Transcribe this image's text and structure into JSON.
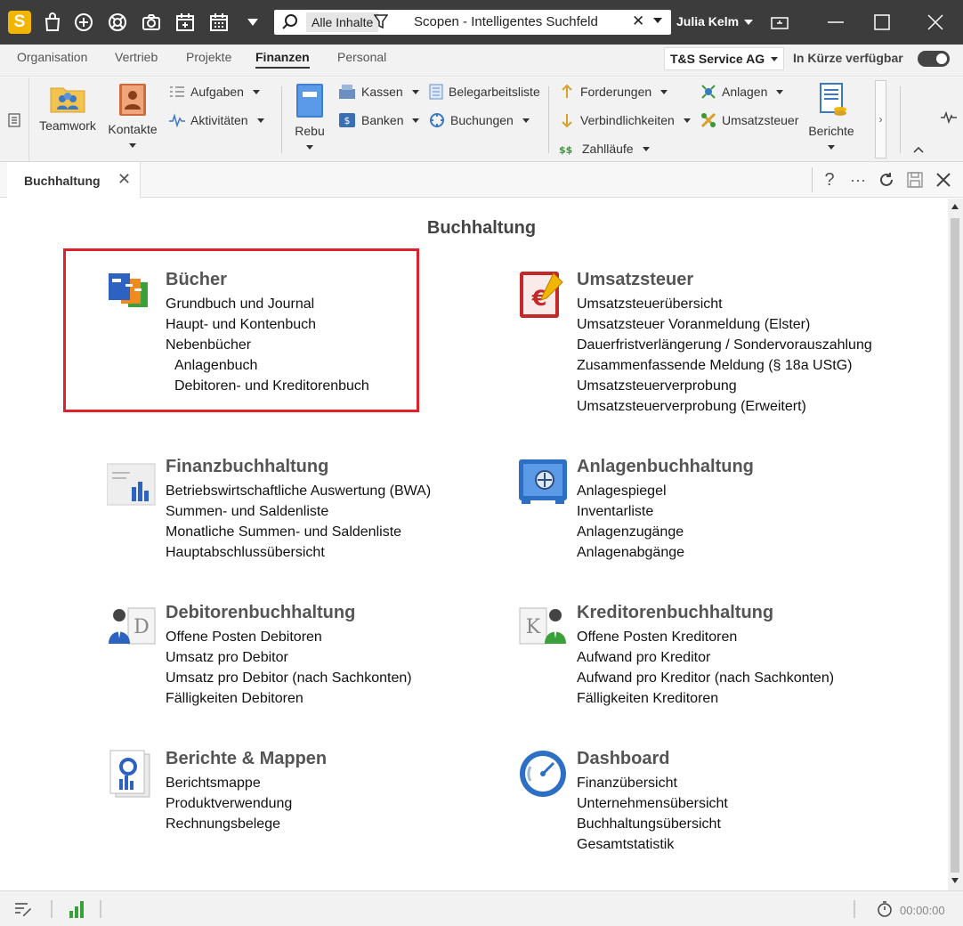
{
  "titlebar": {
    "search_scope": "Alle Inhalte",
    "search_text": "Scopen - Intelligentes Suchfeld",
    "user": "Julia Kelm",
    "app_logo_letter": "S",
    "toolbar_icons": [
      "bag-icon",
      "plus-circle-icon",
      "lifebuoy-icon",
      "camera-icon",
      "calendar-add-icon",
      "calendar-icon",
      "dropdown-triangle-icon"
    ]
  },
  "menu": {
    "tabs": [
      "Organisation",
      "Vertrieb",
      "Projekte",
      "Finanzen",
      "Personal"
    ],
    "active_tab": "Finanzen",
    "company": "T&S Service AG",
    "coming_soon_label": "In Kürze verfügbar"
  },
  "ribbon": {
    "teamwork": "Teamwork",
    "kontakte": "Kontakte",
    "aufgaben": "Aufgaben",
    "aktivitaeten": "Aktivitäten",
    "rebu": "Rebu",
    "kassen": "Kassen",
    "banken": "Banken",
    "belegarbeitsliste": "Belegarbeitsliste",
    "buchungen": "Buchungen",
    "forderungen": "Forderungen",
    "verbindlichkeiten": "Verbindlichkeiten",
    "zahllaeufe": "Zahlläufe",
    "anlagen": "Anlagen",
    "umsatzsteuer": "Umsatzsteuer",
    "berichte": "Berichte"
  },
  "doc_tab": {
    "label": "Buchhaltung"
  },
  "page": {
    "title": "Buchhaltung",
    "sections": {
      "buecher": {
        "title": "Bücher",
        "items": [
          "Grundbuch und Journal",
          "Haupt- und Kontenbuch",
          "Nebenbücher",
          "Anlagenbuch",
          "Debitoren- und Kreditorenbuch"
        ]
      },
      "umsatzsteuer": {
        "title": "Umsatzsteuer",
        "items": [
          "Umsatzsteuerübersicht",
          "Umsatzsteuer Voranmeldung (Elster)",
          "Dauerfristverlängerung / Sondervorauszahlung",
          "Zusammenfassende Meldung (§ 18a UStG)",
          "Umsatzsteuerverprobung",
          "Umsatzsteuerverprobung (Erweitert)"
        ]
      },
      "finanzbuchhaltung": {
        "title": "Finanzbuchhaltung",
        "items": [
          "Betriebswirtschaftliche Auswertung (BWA)",
          "Summen- und Saldenliste",
          "Monatliche Summen- und Saldenliste",
          "Hauptabschlussübersicht"
        ]
      },
      "anlagenbuchhaltung": {
        "title": "Anlagenbuchhaltung",
        "items": [
          "Anlagespiegel",
          "Inventarliste",
          "Anlagenzugänge",
          "Anlagenabgänge"
        ]
      },
      "debitorenbuchhaltung": {
        "title": "Debitorenbuchhaltung",
        "items": [
          "Offene Posten Debitoren",
          "Umsatz pro Debitor",
          "Umsatz pro Debitor (nach Sachkonten)",
          "Fälligkeiten Debitoren"
        ]
      },
      "kreditorenbuchhaltung": {
        "title": "Kreditorenbuchhaltung",
        "items": [
          "Offene Posten Kreditoren",
          "Aufwand pro Kreditor",
          "Aufwand pro Kreditor (nach Sachkonten)",
          "Fälligkeiten Kreditoren"
        ]
      },
      "berichte": {
        "title": "Berichte & Mappen",
        "items": [
          "Berichtsmappe",
          "Produktverwendung",
          "Rechnungsbelege"
        ]
      },
      "dashboard": {
        "title": "Dashboard",
        "items": [
          "Finanzübersicht",
          "Unternehmensübersicht",
          "Buchhaltungsübersicht",
          "Gesamtstatistik"
        ]
      }
    }
  },
  "icon_letters": {
    "debitor": "D",
    "kreditor": "K",
    "vat": "€"
  },
  "statusbar": {
    "timer": "00:00:00"
  },
  "colors": {
    "titlebar": "#3c3c3c",
    "highlight": "#e0202a",
    "logo": "#f2b600"
  }
}
